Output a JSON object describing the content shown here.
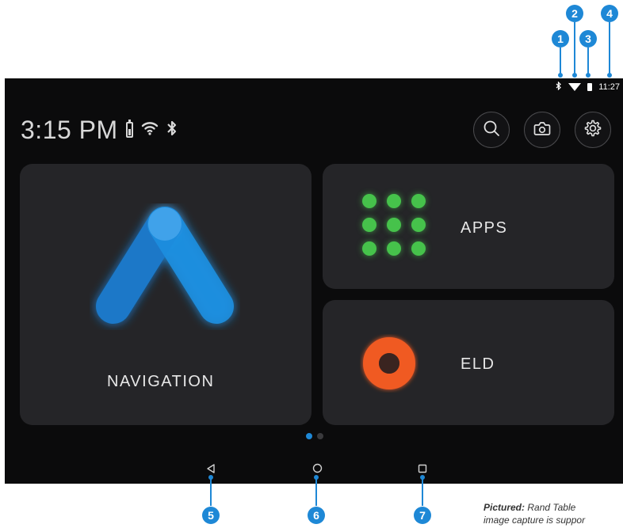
{
  "status_bar": {
    "time": "11:27",
    "bluetooth_icon": "bluetooth-icon",
    "wifi_icon": "wifi-icon",
    "battery_icon": "battery-icon"
  },
  "header": {
    "time": "3:15 PM",
    "battery_icon": "battery-icon",
    "wifi_icon": "wifi-icon",
    "bluetooth_icon": "bluetooth-icon"
  },
  "actions": {
    "search_icon": "search-icon",
    "camera_icon": "camera-icon",
    "settings_icon": "gear-icon"
  },
  "tiles": {
    "navigation": {
      "label": "NAVIGATION",
      "icon": "navigation-logo-icon"
    },
    "apps": {
      "label": "APPS",
      "icon": "app-grid-icon"
    },
    "eld": {
      "label": "ELD",
      "icon": "eld-ring-icon"
    }
  },
  "pager": {
    "pages": 2,
    "active": 1
  },
  "nav_bar": {
    "back_icon": "back-triangle-icon",
    "home_icon": "home-circle-icon",
    "recents_icon": "recents-square-icon"
  },
  "callouts": [
    "1",
    "2",
    "3",
    "4",
    "5",
    "6",
    "7"
  ],
  "caption": {
    "bold": "Pictured:",
    "text": " Rand Table",
    "line2": "image capture is suppor"
  },
  "colors": {
    "accent": "#1e88d6",
    "screen_bg": "#0b0b0c",
    "tile_bg": "#252528",
    "apps_green": "#46c24b",
    "eld_orange": "#f05a24",
    "nav_blue": "#1f8fe0"
  }
}
